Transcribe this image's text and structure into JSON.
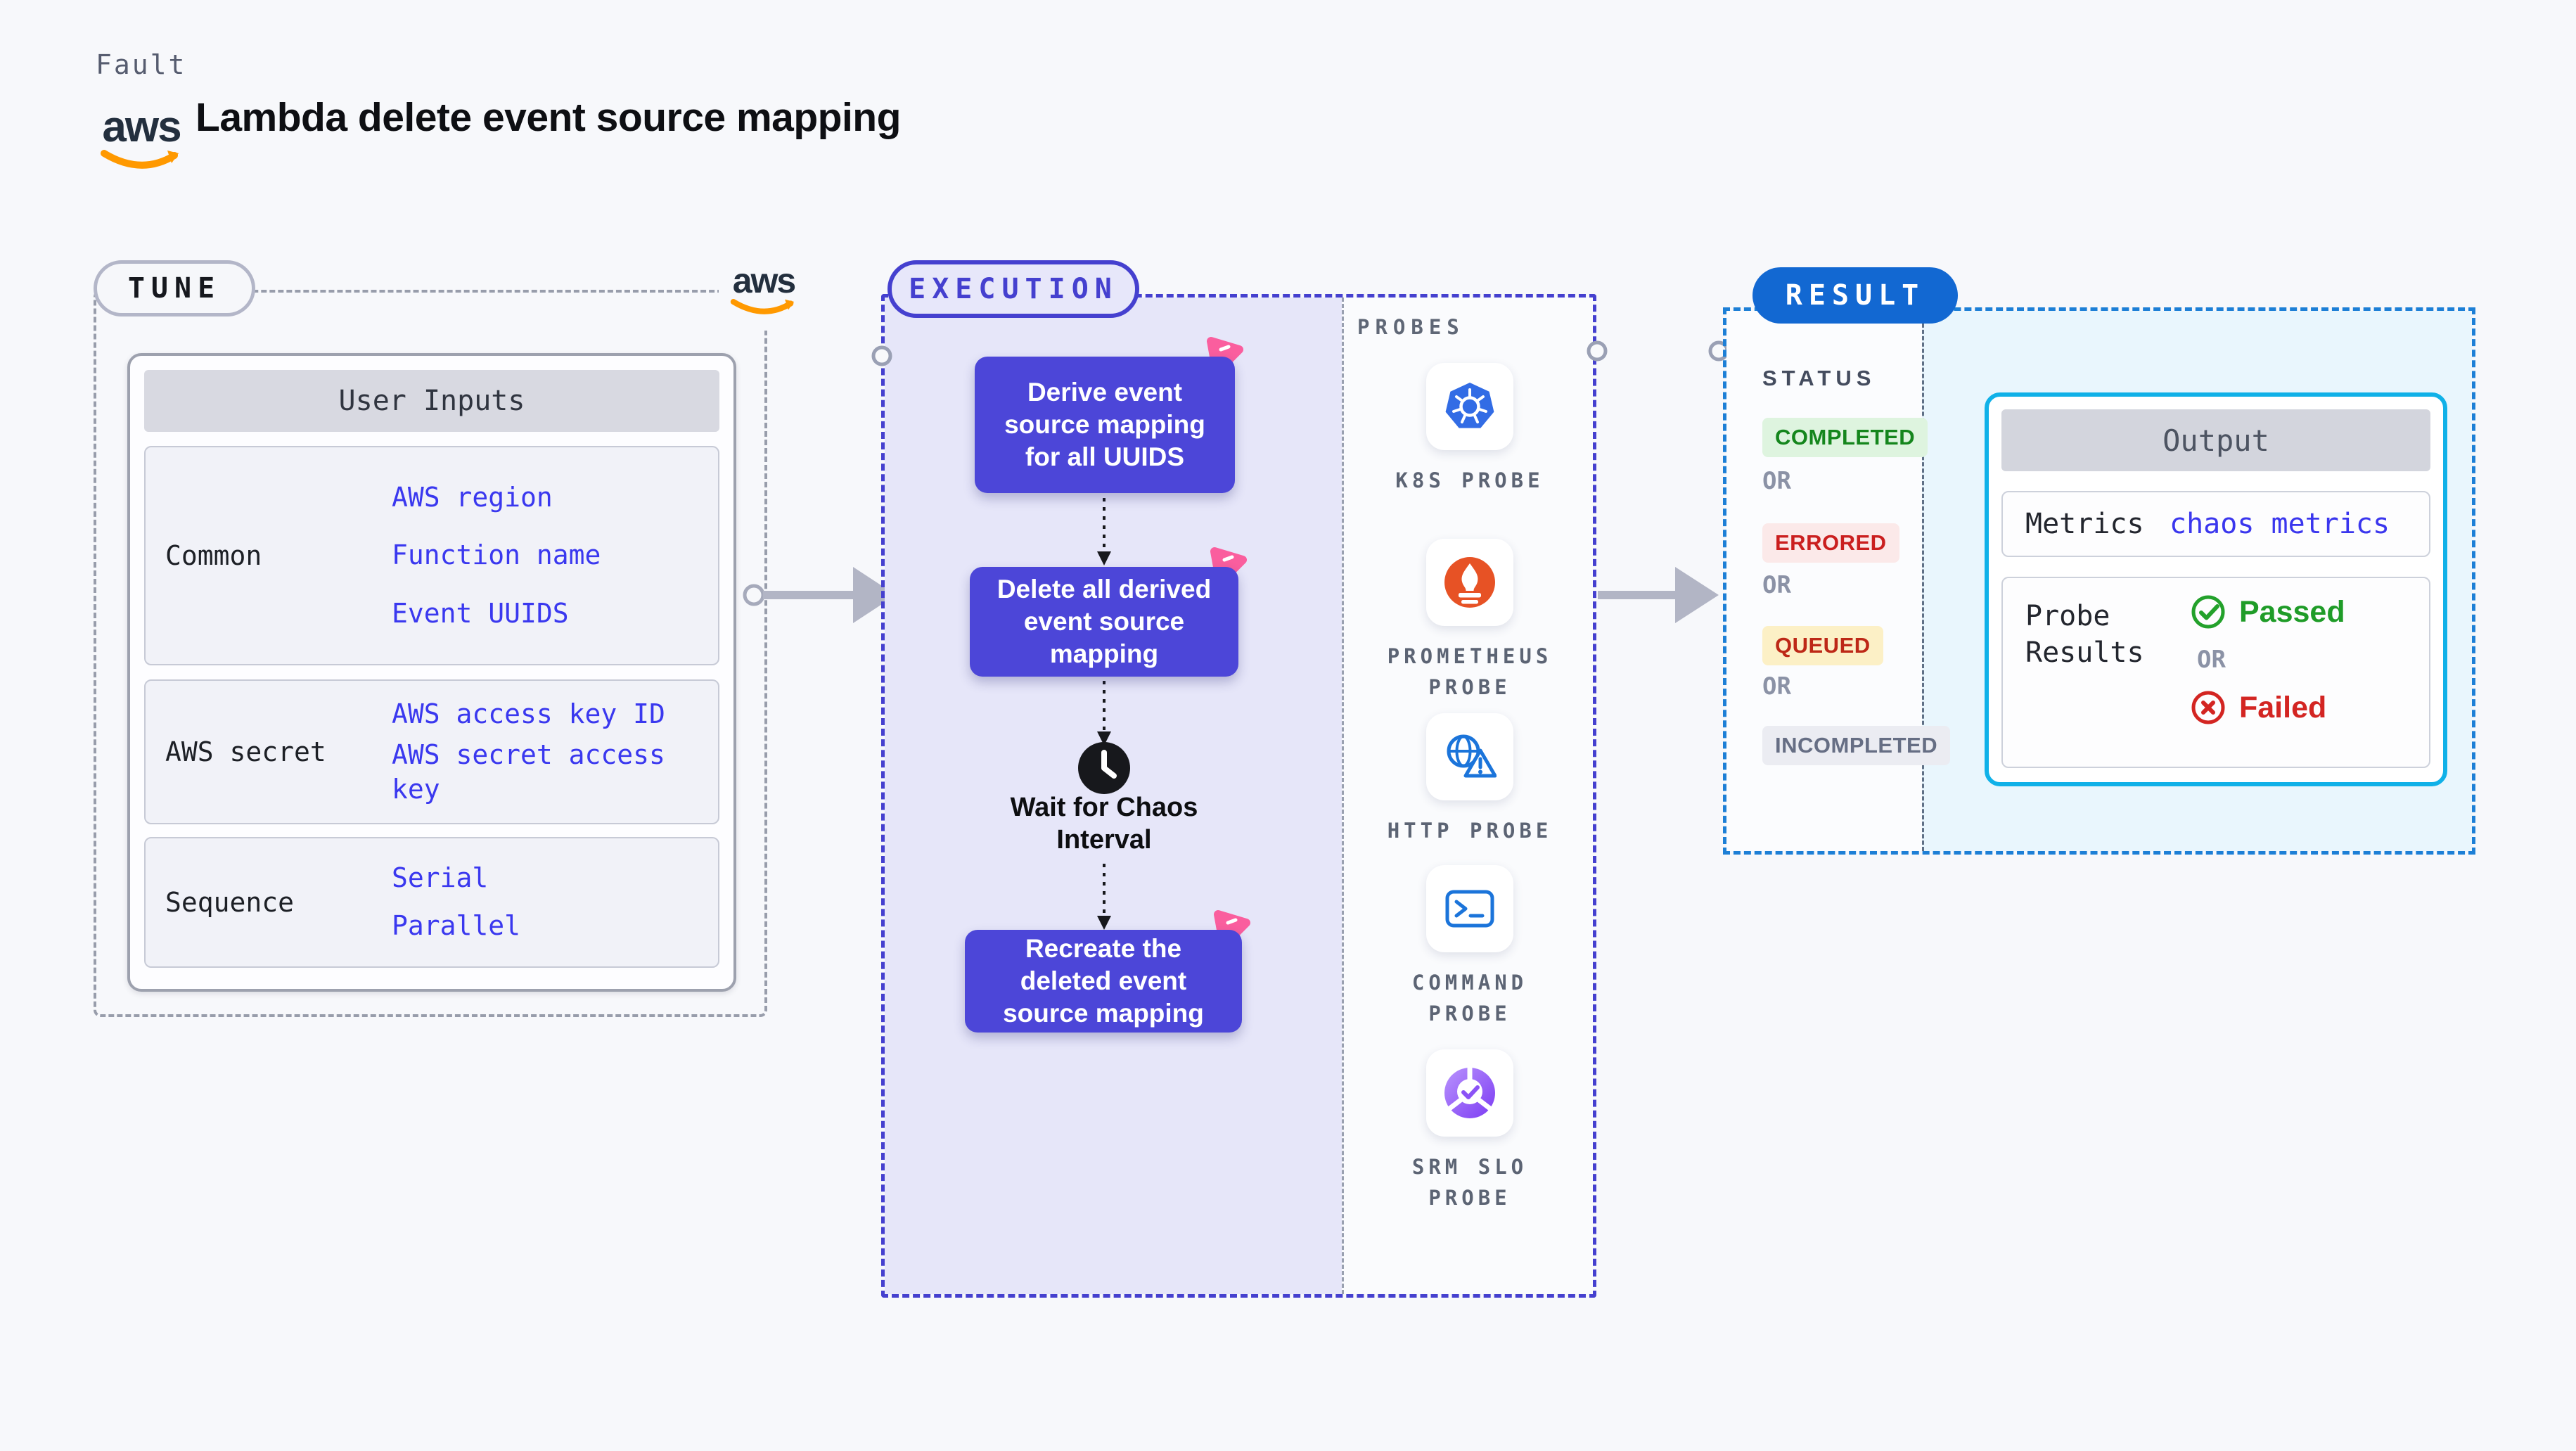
{
  "header": {
    "kicker": "Fault",
    "title": "Lambda delete event source mapping",
    "aws_logo_text": "aws"
  },
  "tune": {
    "pill_label": "TUNE",
    "aws_logo_text": "aws",
    "table": {
      "header": "User Inputs",
      "rows": [
        {
          "label": "Common",
          "values": [
            "AWS region",
            "Function name",
            "Event UUIDS"
          ]
        },
        {
          "label": "AWS secret",
          "values": [
            "AWS access key ID",
            "AWS secret access key"
          ]
        },
        {
          "label": "Sequence",
          "values": [
            "Serial",
            "Parallel"
          ]
        }
      ]
    }
  },
  "execution": {
    "pill_label": "EXECUTION",
    "nodes": [
      "Derive event source mapping for all UUIDS",
      "Delete all derived event source mapping",
      "Recreate the deleted event source mapping"
    ],
    "wait_label": "Wait for Chaos Interval",
    "probes": {
      "title": "PROBES",
      "items": [
        {
          "icon": "kubernetes-icon",
          "label": "K8S PROBE"
        },
        {
          "icon": "prometheus-icon",
          "label": "PROMETHEUS PROBE"
        },
        {
          "icon": "http-globe-icon",
          "label": "HTTP PROBE"
        },
        {
          "icon": "command-terminal-icon",
          "label": "COMMAND PROBE"
        },
        {
          "icon": "srm-slo-icon",
          "label": "SRM SLO PROBE"
        }
      ]
    }
  },
  "result": {
    "pill_label": "RESULT",
    "status_label": "STATUS",
    "or_label": "OR",
    "statuses": [
      {
        "label": "COMPLETED",
        "bg": "#def4df",
        "color": "#15861d"
      },
      {
        "label": "ERRORED",
        "bg": "#fbe9e9",
        "color": "#ca1f1f"
      },
      {
        "label": "QUEUED",
        "bg": "#fcf0c6",
        "color": "#bd2817"
      },
      {
        "label": "INCOMPLETED",
        "bg": "#ebecf2",
        "color": "#666e84"
      }
    ],
    "output": {
      "header": "Output",
      "metrics_label": "Metrics",
      "metrics_value": "chaos metrics",
      "probe_results_label": "Probe Results",
      "passed_label": "Passed",
      "or_label": "OR",
      "failed_label": "Failed"
    }
  },
  "colors": {
    "page_bg": "#f7f8fb",
    "execution_accent": "#4540cf",
    "execution_panel": "#e6e6f9",
    "node_fill": "#4c46d8",
    "node_badge_pink": "#fa5e9e",
    "tune_dash": "#989dab",
    "result_accent": "#1d7fd6",
    "result_pill": "#1268d2",
    "result_panel": "#e9f6fd",
    "output_border": "#10b1e8",
    "link_blue": "#3a38ef",
    "passed_green": "#1f9c28",
    "failed_red": "#d32522",
    "aws_orange": "#ff9900",
    "kubernetes_blue": "#326ce5",
    "prometheus_orange": "#e75225",
    "arrow_gray": "#b2b5c5"
  }
}
